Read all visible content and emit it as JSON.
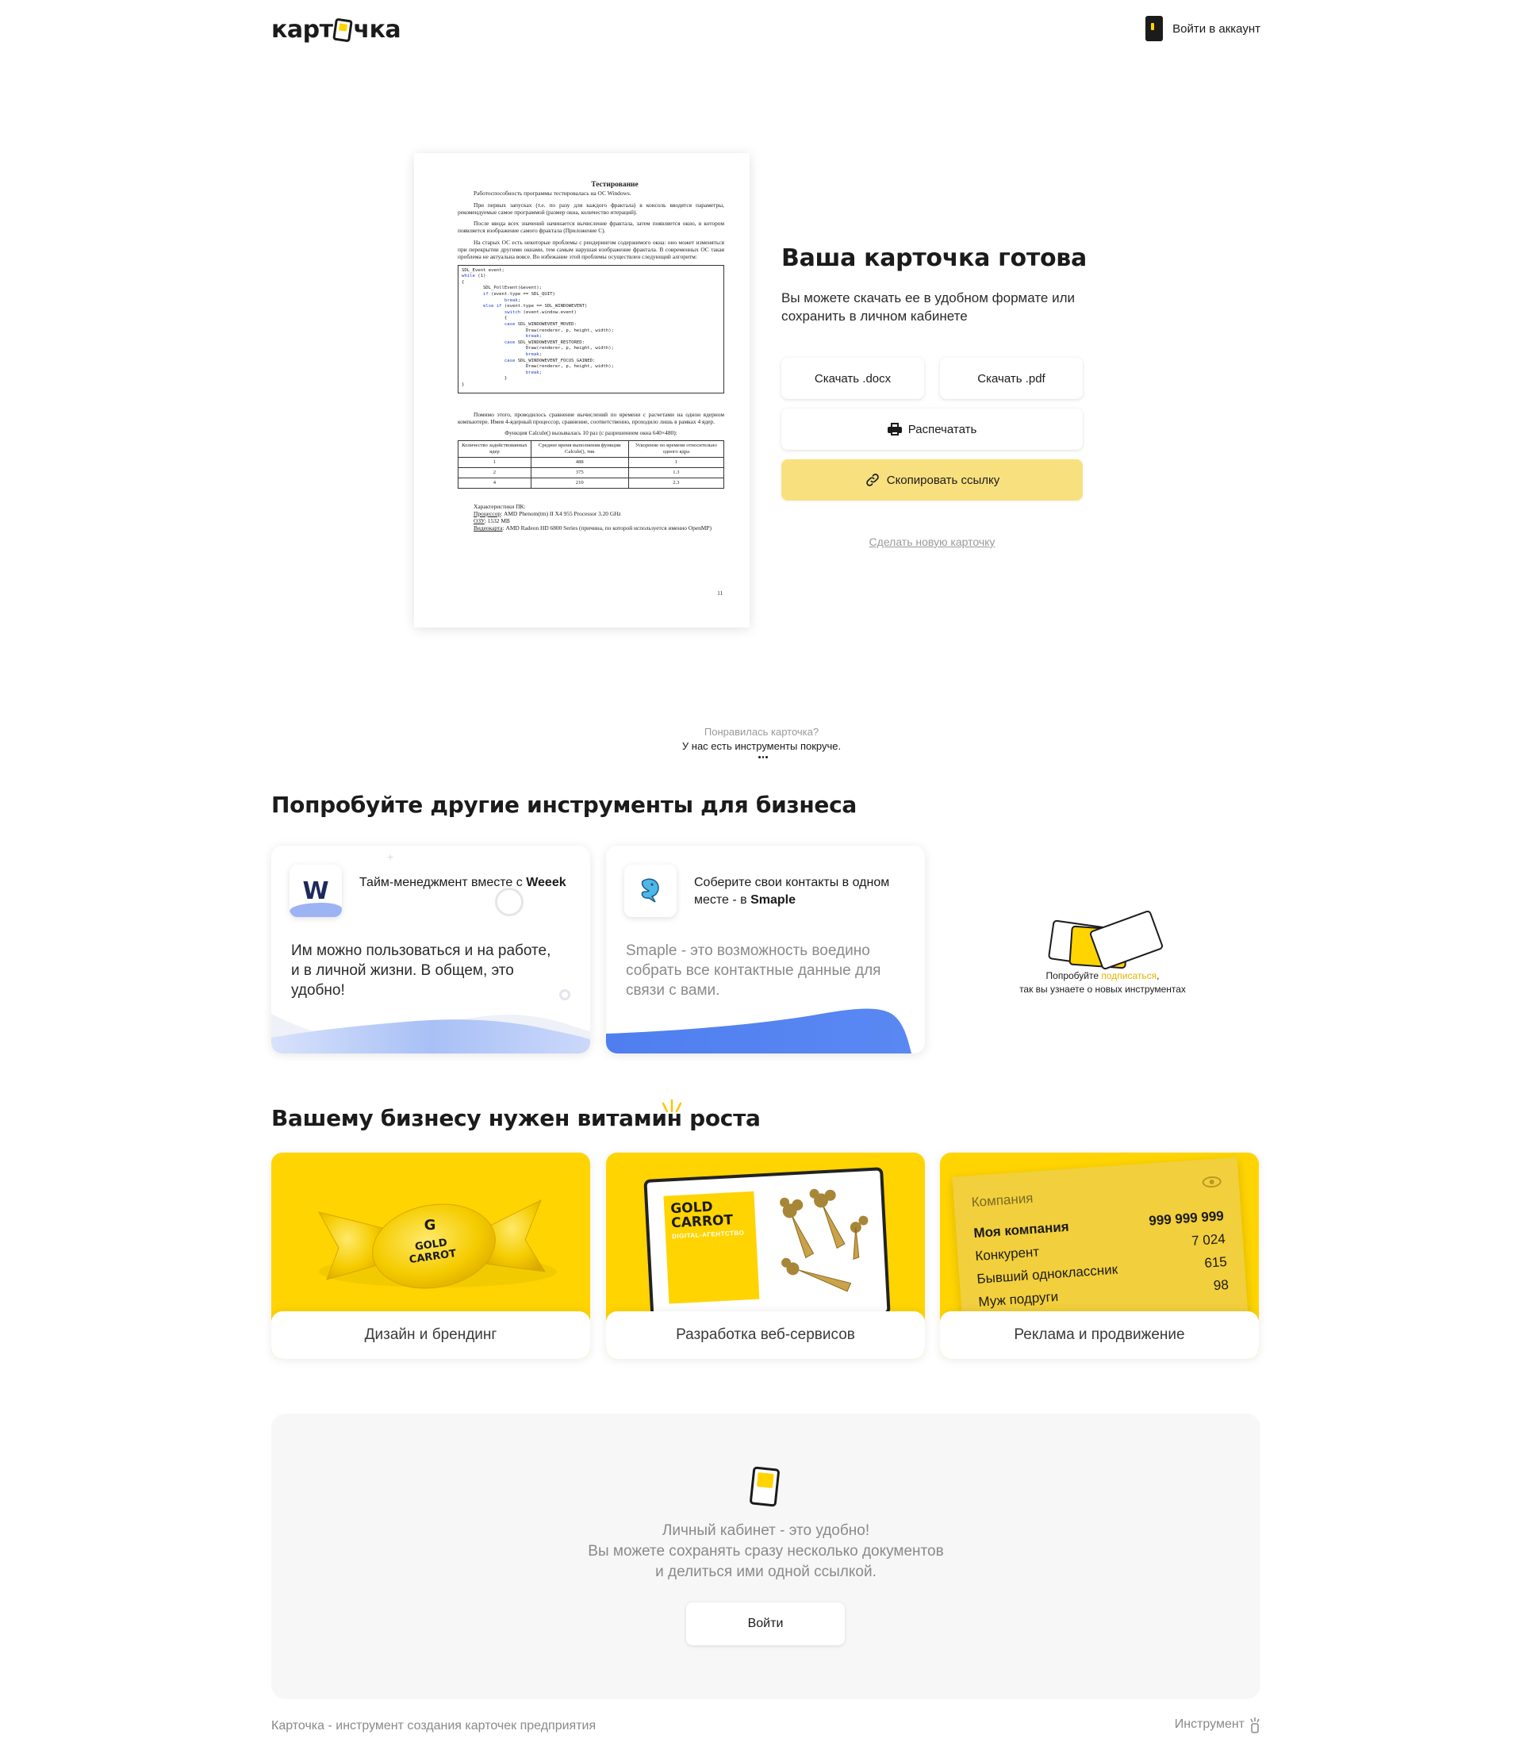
{
  "header": {
    "logo_text_left": "карт",
    "logo_text_right": "чка",
    "login_label": "Войти в аккаунт"
  },
  "document": {
    "title": "Тестирование",
    "para1": "Работоспособность программы тестировалась на ОС Windows.",
    "para2": "При первых запусках (т.е. по разу для каждого фрактала) в консоль вводятся параметры, рекомендуемые самое программой (размер окна, количество итераций).",
    "para3": "После ввода всех значений начинается вычисление фрактала, затем появляется окно, в котором появляется изображение самого фрактала (Приложение С).",
    "para4": "На старых ОС есть некоторые проблемы с рендерингом содержимого окна: оно может изменяться при перекрытии другими окнами, тем самым нарушая изображение фрактала. В современных ОС такая проблема не актуальна вовсе. Во избежание этой проблемы осуществлен следующий алгоритм:",
    "code": [
      "SDL_Event event;",
      "while (1)",
      "{",
      "        SDL_PollEvent(&event);",
      "        if (event.type == SDL_QUIT)",
      "                break;",
      "        else if (event.type == SDL_WINDOWEVENT)",
      "                switch (event.window.event)",
      "                {",
      "                case SDL_WINDOWEVENT_MOVED:",
      "                        Draw(renderer, p, height, width);",
      "                        break;",
      "                case SDL_WINDOWEVENT_RESTORED:",
      "                        Draw(renderer, p, height, width);",
      "                        break;",
      "                case SDL_WINDOWEVENT_FOCUS_GAINED:",
      "                        Draw(renderer, p, height, width);",
      "                        break;",
      "                }",
      "}"
    ],
    "para5": "Помимо этого, проводилось сравнение вычислений по времени с расчетами на однои ядерном компьютере. Имея 4-ядерный процессор, сравнение, соответственно, проходило лишь в рамках 4 ядер.",
    "caption": "Функция Calcule() вызывалась 10 раз (с разрешением окна 640×480):",
    "table_headers": [
      "Количество задействованных ядер",
      "Среднее время выполнения функции Calcule(), тик",
      "Ускорение по времени относительно одного ядра"
    ],
    "table_rows": [
      [
        "1",
        "488",
        "1"
      ],
      [
        "2",
        "375",
        "1.3"
      ],
      [
        "4",
        "210",
        "2.3"
      ]
    ],
    "specs_title": "Характеристики ПК:",
    "spec_cpu_label": "Процессор",
    "spec_cpu": ": AMD Phenom(tm) II X4 955 Processor 3.20 GHz",
    "spec_ram_label": "ОЗУ",
    "spec_ram": ": 1532 MB",
    "spec_gpu_label": "Видеокарта",
    "spec_gpu": ": AMD Radeon HD 6800 Series (причина, по которой используется именно OpenMP)",
    "page_number": "11"
  },
  "ready": {
    "title": "Ваша карточка готова",
    "subtitle": "Вы можете скачать ее в удобном формате или сохранить в личном кабинете",
    "btn_docx": "Скачать .docx",
    "btn_pdf": "Скачать .pdf",
    "btn_print": "Распечатать",
    "btn_copy": "Скопировать ссылку",
    "new_card": "Сделать новую карточку"
  },
  "transition": {
    "question": "Понравилась карточка?",
    "answer": "У нас есть инструменты покруче."
  },
  "tools": {
    "title": "Попробуйте другие инструменты для бизнеса",
    "weeek": {
      "logo": "W",
      "head_prefix": "Тайм-менеджмент вместе с ",
      "head_brand": "Weeek",
      "body": "Им можно пользоваться и на работе, и в личной жизни. В общем, это удобно!"
    },
    "smaple": {
      "head_prefix": "Соберите свои контакты в одном месте - в ",
      "head_brand": "Smaple",
      "body": "Smaple - это возможность воедино собрать все контактные данные для связи с вами."
    },
    "subscribe_prefix": "Попробуйте ",
    "subscribe_link": "подписаться",
    "subscribe_suffix": ",",
    "subscribe_line2": "так вы узнаете о новых инструментах"
  },
  "vitamin": {
    "title": "Вашему бизнесу нужен витамин роста",
    "cards": [
      {
        "label": "Дизайн и брендинг",
        "candy_letter": "G",
        "candy_line1": "GOLD",
        "candy_line2": "CARROT"
      },
      {
        "label": "Разработка веб-сервисов",
        "mock_title_1": "GOLD",
        "mock_title_2": "CARROT",
        "mock_sub": "DIGITAL-АГЕНТСТВО"
      },
      {
        "label": "Реклама и продвижение",
        "company_head": "Компания",
        "rows": [
          [
            "Моя компания",
            "999 999 999"
          ],
          [
            "Конкурент",
            "7 024"
          ],
          [
            "Бывший одноклассник",
            "615"
          ],
          [
            "Муж подруги",
            "98"
          ]
        ]
      }
    ]
  },
  "cabinet": {
    "line1": "Личный кабинет - это удобно!",
    "line2": "Вы можете сохранять сразу несколько документов",
    "line3": "и делиться ими одной ссылкой.",
    "button": "Войти"
  },
  "footer": {
    "left": "Карточка - инструмент создания карточек предприятия",
    "right": "Инструмент"
  },
  "colors": {
    "accent": "#ffd400",
    "copy_button": "#f9e07f",
    "link_yellow": "#e2b400",
    "weeek_wave": "#9cb3f4",
    "smaple_wave": "#4f7ef0"
  }
}
